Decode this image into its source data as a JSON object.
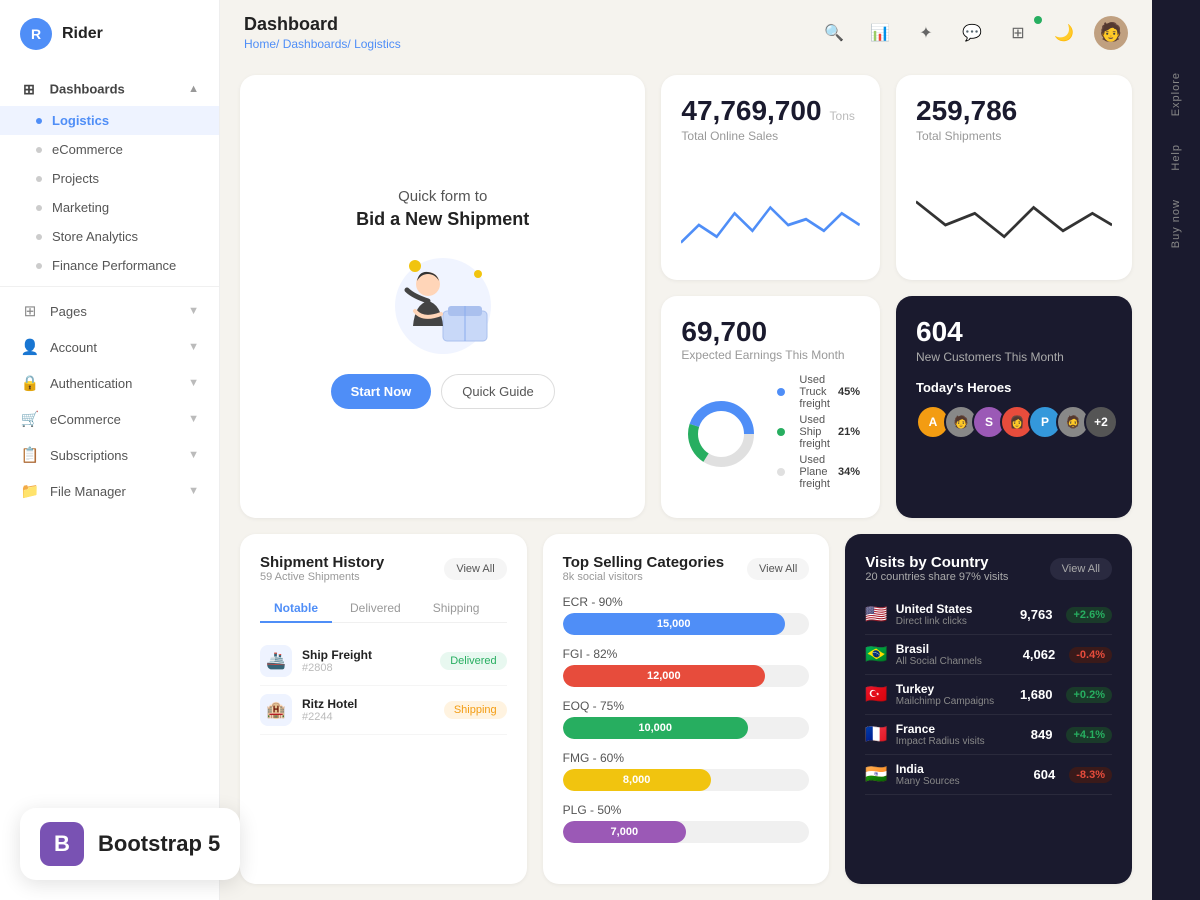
{
  "app": {
    "logo_letter": "R",
    "logo_name": "Rider"
  },
  "sidebar": {
    "dashboards_label": "Dashboards",
    "items": [
      {
        "id": "logistics",
        "label": "Logistics",
        "active": true
      },
      {
        "id": "ecommerce",
        "label": "eCommerce",
        "active": false
      },
      {
        "id": "projects",
        "label": "Projects",
        "active": false
      },
      {
        "id": "marketing",
        "label": "Marketing",
        "active": false
      },
      {
        "id": "store-analytics",
        "label": "Store Analytics",
        "active": false
      },
      {
        "id": "finance-performance",
        "label": "Finance Performance",
        "active": false
      }
    ],
    "nav_items": [
      {
        "id": "pages",
        "label": "Pages",
        "icon": "⊞"
      },
      {
        "id": "account",
        "label": "Account",
        "icon": "👤"
      },
      {
        "id": "authentication",
        "label": "Authentication",
        "icon": "🔒"
      },
      {
        "id": "ecommerce-nav",
        "label": "eCommerce",
        "icon": "🛒"
      },
      {
        "id": "subscriptions",
        "label": "Subscriptions",
        "icon": "📋"
      },
      {
        "id": "file-manager",
        "label": "File Manager",
        "icon": "📁"
      }
    ]
  },
  "header": {
    "page_title": "Dashboard",
    "breadcrumb_home": "Home/",
    "breadcrumb_dashboards": "Dashboards/",
    "breadcrumb_current": "Logistics"
  },
  "promo": {
    "title": "Quick form to",
    "subtitle": "Bid a New Shipment",
    "btn_primary": "Start Now",
    "btn_secondary": "Quick Guide"
  },
  "stats": {
    "total_online_sales_value": "47,769,700",
    "total_online_sales_unit": "Tons",
    "total_online_sales_label": "Total Online Sales",
    "total_shipments_value": "259,786",
    "total_shipments_label": "Total Shipments",
    "expected_earnings_value": "69,700",
    "expected_earnings_label": "Expected Earnings This Month",
    "new_customers_value": "604",
    "new_customers_label": "New Customers This Month"
  },
  "freight": {
    "items": [
      {
        "name": "Used Truck freight",
        "pct": "45%",
        "color": "#4f8ef7"
      },
      {
        "name": "Used Ship freight",
        "pct": "21%",
        "color": "#27ae60"
      },
      {
        "name": "Used Plane freight",
        "pct": "34%",
        "color": "#e0e0e0"
      }
    ]
  },
  "heroes": {
    "section_label": "Today's Heroes",
    "avatars": [
      {
        "initial": "A",
        "color": "#f39c12"
      },
      {
        "initial": "S",
        "color": "#9b59b6"
      },
      {
        "initial": "P",
        "color": "#3498db"
      },
      {
        "initial": "+2",
        "color": "#555"
      }
    ]
  },
  "shipment_history": {
    "title": "Shipment History",
    "subtitle": "59 Active Shipments",
    "view_all": "View All",
    "tabs": [
      "Notable",
      "Delivered",
      "Shipping"
    ],
    "active_tab": "Notable",
    "items": [
      {
        "icon": "🚢",
        "name": "Ship Freight",
        "id": "#2808",
        "status": "Delivered",
        "status_type": "delivered"
      },
      {
        "icon": "🏨",
        "name": "Ritz Hotel",
        "id": "#2244",
        "status": "Shipping",
        "status_type": "shipping"
      }
    ]
  },
  "top_selling": {
    "title": "Top Selling Categories",
    "subtitle": "8k social visitors",
    "view_all": "View All",
    "items": [
      {
        "label": "ECR - 90%",
        "value": 15000,
        "display": "15,000",
        "color": "#4f8ef7",
        "width": "90%"
      },
      {
        "label": "FGI - 82%",
        "value": 12000,
        "display": "12,000",
        "color": "#e74c3c",
        "width": "82%"
      },
      {
        "label": "EOQ - 75%",
        "value": 10000,
        "display": "10,000",
        "color": "#27ae60",
        "width": "75%"
      },
      {
        "label": "FMG - 60%",
        "value": 8000,
        "display": "8,000",
        "color": "#f1c40f",
        "width": "60%"
      },
      {
        "label": "PLG - 50%",
        "value": 7000,
        "display": "7,000",
        "color": "#9b59b6",
        "width": "50%"
      }
    ]
  },
  "visits_by_country": {
    "title": "Visits by Country",
    "subtitle": "20 countries share 97% visits",
    "view_all": "View All",
    "items": [
      {
        "flag": "🇺🇸",
        "name": "United States",
        "source": "Direct link clicks",
        "visits": "9,763",
        "change": "+2.6%",
        "up": true
      },
      {
        "flag": "🇧🇷",
        "name": "Brasil",
        "source": "All Social Channels",
        "visits": "4,062",
        "change": "-0.4%",
        "up": false
      },
      {
        "flag": "🇹🇷",
        "name": "Turkey",
        "source": "Mailchimp Campaigns",
        "visits": "1,680",
        "change": "+0.2%",
        "up": true
      },
      {
        "flag": "🇫🇷",
        "name": "France",
        "source": "Impact Radius visits",
        "visits": "849",
        "change": "+4.1%",
        "up": true
      },
      {
        "flag": "🇮🇳",
        "name": "India",
        "source": "Many Sources",
        "visits": "604",
        "change": "-8.3%",
        "up": false
      }
    ]
  },
  "right_panel": {
    "items": [
      "Explore",
      "Help",
      "Buy now"
    ]
  },
  "watermark": {
    "icon": "B",
    "text": "Bootstrap 5"
  }
}
